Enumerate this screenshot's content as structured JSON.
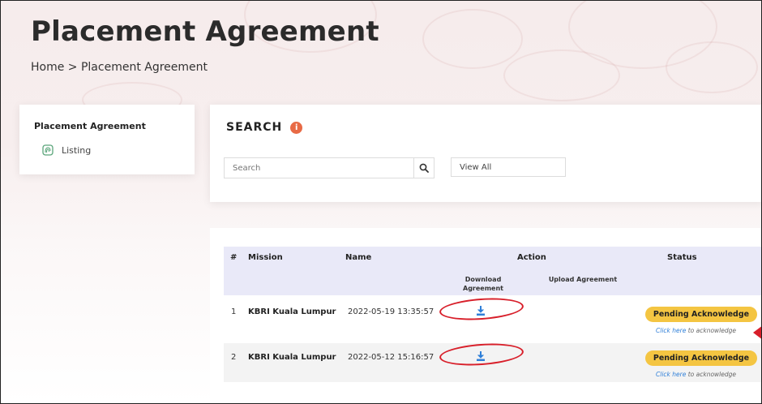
{
  "page": {
    "title": "Placement Agreement",
    "breadcrumb": "Home > Placement Agreement"
  },
  "sidebar": {
    "title": "Placement Agreement",
    "items": [
      {
        "label": "Listing",
        "icon": "fingerprint-icon"
      }
    ]
  },
  "search": {
    "heading": "SEARCH",
    "info_icon": "i",
    "placeholder": "Search",
    "view_all_label": "View All"
  },
  "table": {
    "headers": {
      "number": "#",
      "mission": "Mission",
      "name": "Name",
      "action": "Action",
      "status": "Status",
      "download_line1": "Download",
      "download_line2": "Agreement",
      "upload": "Upload Agreement"
    },
    "rows": [
      {
        "number": "1",
        "mission": "KBRI Kuala Lumpur",
        "name": "2022-05-19 13:35:57",
        "status": "Pending Acknowledge",
        "ack_link": "Click here",
        "ack_text": " to acknowledge"
      },
      {
        "number": "2",
        "mission": "KBRI Kuala Lumpur",
        "name": "2022-05-12 15:16:57",
        "status": "Pending Acknowledge",
        "ack_link": "Click here",
        "ack_text": " to acknowledge"
      }
    ]
  },
  "colors": {
    "badge": "#f4c542",
    "annotation": "#d81f2a",
    "link": "#2f7fd8",
    "header_bg": "#e9e9f8",
    "info_icon": "#e86a45"
  }
}
